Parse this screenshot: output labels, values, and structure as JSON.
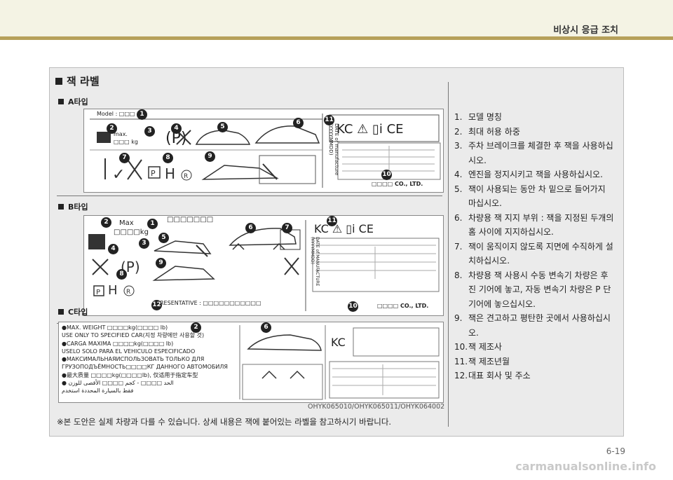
{
  "header": {
    "section_title": "비상시 응급 조치"
  },
  "panel": {
    "title": "잭 라벨",
    "types": [
      {
        "label": "A타입"
      },
      {
        "label": "B타입"
      },
      {
        "label": "C타입"
      }
    ],
    "a_label": {
      "model": "Model : □□□",
      "max": "max.",
      "max_kg": "□□□ kg",
      "date": "DATE of manufacture (YYYYMMDD)",
      "company": "□□□□ CO., LTD."
    },
    "b_label": {
      "max": "Max",
      "max_kg": "□□□□kg",
      "model_box": "□□□□□□□",
      "representative": "RESENTATIVE : □□□□□□□□□□□",
      "date": "DATE of MANUFACTURE (YYYYMMDD)",
      "company": "□□□□  CO., LTD."
    },
    "c_label": {
      "lines": [
        "●MAX. WEIGHT □□□□kg(□□□□ lb)",
        "USE ONLY TO SPECIFIED CAR(지정 차량에만 사용할 것)",
        "●CARGA MAXIMA □□□□kg(□□□□ lb)",
        "USELO SOLO PARA EL VEHICULO ESPECIFICADO",
        "●МАКСИМАЛЬНАЯИСПОЛЬЗОВАТЬ ТОЛЬКО ДЛЯ",
        "ГРУЗОПОДЪЁМНОСТЬ□□□□КГ ДАННОГО АВТОМОБИЛЯ",
        "●最大质量 □□□□kg(□□□□lb), 仅适用于指定车型",
        "● الحد □□□□ - كجم □□□□ الأقصى للوزن",
        "فقط بالسيارة المحددة استخدم"
      ]
    },
    "image_code": "OHYK065010/OHYK065011/OHYK064002",
    "footnote": "※본 도안은 실제 차량과 다를 수 있습니다. 상세 내용은 잭에 붙어있는 라벨을 참고하시기 바랍니다.",
    "items": [
      {
        "num": "1.",
        "text": "모델 명칭"
      },
      {
        "num": "2.",
        "text": "최대 허용 하중"
      },
      {
        "num": "3.",
        "text": "주차 브레이크를 체결한 후 잭을 사용하십시오."
      },
      {
        "num": "4.",
        "text": "엔진을 정지시키고 잭을 사용하십시오."
      },
      {
        "num": "5.",
        "text": "잭이 사용되는 동안 차 밑으로 들어가지 마십시오."
      },
      {
        "num": "6.",
        "text": "차량용 잭 지지 부위 : 잭을 지정된 두개의 홈 사이에 지지하십시오."
      },
      {
        "num": "7.",
        "text": "잭이 움직이지 않도록 지면에 수직하게 설치하십시오."
      },
      {
        "num": "8.",
        "text": "차량용 잭 사용시 수동 변속기 차량은 후진 기어에 놓고, 자동 변속기 차량은 P 단 기어에 놓으십시오."
      },
      {
        "num": "9.",
        "text": "잭은 견고하고 평탄한 곳에서 사용하십시오."
      },
      {
        "num": "10.",
        "text": "잭 제조사"
      },
      {
        "num": "11.",
        "text": "잭 제조년월"
      },
      {
        "num": "12.",
        "text": "대표 회사 및 주소"
      }
    ]
  },
  "footer": {
    "page": "6-19",
    "watermark": "carmanualsonline.info"
  }
}
